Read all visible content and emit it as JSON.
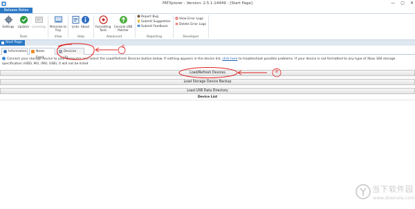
{
  "window": {
    "title": "FATXplorer - Version: 2.5.1.14449 - [Start Page]",
    "controls": [
      "—",
      "▢",
      "✕"
    ]
  },
  "ribbon": {
    "tab_label": "Release Notes",
    "groups": {
      "tools": {
        "label": "Tools",
        "buttons": [
          {
            "label": "Settings",
            "icon": "gear-icon"
          },
          {
            "label": "Updater",
            "icon": "update-icon"
          },
          {
            "label": "Licensing",
            "icon": "license-icon"
          }
        ]
      },
      "view": {
        "label": "View",
        "buttons": [
          {
            "label": "Minimize to Tray",
            "icon": "minimize-tray-icon"
          }
        ]
      },
      "help": {
        "label": "Help",
        "buttons": [
          {
            "label": "Links",
            "icon": "links-icon"
          },
          {
            "label": "About",
            "icon": "about-icon"
          }
        ]
      },
      "advanced": {
        "label": "Advanced",
        "buttons": [
          {
            "label": "Formatting Tools",
            "icon": "formatting-icon"
          },
          {
            "label": "Console USB Patcher",
            "icon": "usb-patcher-icon"
          }
        ]
      },
      "reporting": {
        "label": "Reporting",
        "items": [
          "Report Bug",
          "Submit Suggestion",
          "Submit Feedback"
        ]
      },
      "developer": {
        "label": "Developer",
        "items": [
          "View Error Logs",
          "Delete Error Logs"
        ]
      }
    }
  },
  "document_tab": {
    "label": "Start Page"
  },
  "content_tabs": [
    {
      "label": "Information"
    },
    {
      "label": "News Feed"
    },
    {
      "label": "Devices (0)"
    }
  ],
  "info": {
    "text_before": "Connect your storage device to your computer and select the Load/Refresh Devices button below. If nothing appears in the device list,",
    "link": "click here",
    "text_after": "to troubleshoot possible problems. If your device is not formatted to any type of Xbox 360 storage specification (HDD, MU, (MU, USB), it will not be listed."
  },
  "actions": {
    "load_refresh": "Load/Refresh Devices",
    "load_backup": "Load Storage Device Backup",
    "load_usb": "Load USB Data Directory"
  },
  "device_list": {
    "header": "Device List"
  },
  "annotations": {
    "one": "①",
    "two": "②"
  },
  "watermark": {
    "title": "当下软件园",
    "subtitle": "www.downxia.com"
  },
  "colors": {
    "accent": "#2b78c5",
    "annotation": "#e02020"
  }
}
